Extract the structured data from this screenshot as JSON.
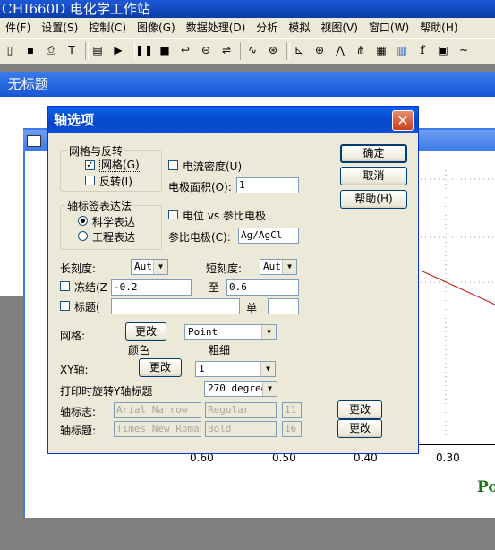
{
  "app": {
    "title": "CHI660D 电化学工作站"
  },
  "menu": [
    "件(F)",
    "设置(S)",
    "控制(C)",
    "图像(G)",
    "数据处理(D)",
    "分析",
    "模拟",
    "视图(V)",
    "窗口(W)",
    "帮助(H)"
  ],
  "toolbar_icons": [
    "new-file-icon",
    "save-icon",
    "print-icon",
    "text-icon",
    "notes-icon",
    "run-icon",
    "pause-icon",
    "stop-icon",
    "reverse-icon",
    "step-icon",
    "parameter-icon",
    "waveform-icon",
    "settings-icon",
    "graph-icon",
    "zoom-icon",
    "peak-icon",
    "overlay-icon",
    "multi-graph-icon",
    "color-icon",
    "font-icon",
    "copy-icon",
    "smooth-icon"
  ],
  "document": {
    "title": "无标题"
  },
  "plot": {
    "x_ticks": [
      "0.60",
      "0.50",
      "0.40",
      "0.30"
    ],
    "partial_label": "Po"
  },
  "dialog": {
    "title": "轴选项",
    "grid_group": {
      "title": "网格与反转",
      "grid_label": "网格(G)",
      "grid_checked": true,
      "invert_label": "反转(I)",
      "invert_checked": false
    },
    "current_density_label": "电流密度(U)",
    "current_density_checked": false,
    "electrode_area_label": "电极面积(O):",
    "electrode_area_value": "1",
    "ok_label": "确定",
    "cancel_label": "取消",
    "help_label": "帮助(H)",
    "notation_group": {
      "title": "轴标签表达法",
      "scientific_label": "科学表达",
      "engineering_label": "工程表达",
      "selected": "科学表达"
    },
    "potential_vs_ref_label": "电位 vs 参比电极",
    "potential_vs_ref_checked": false,
    "ref_electrode_label": "参比电极(C):",
    "ref_electrode_value": "Ag/AgCl",
    "major_tick_label": "长刻度:",
    "major_tick_value": "Aut",
    "minor_tick_label": "短刻度:",
    "minor_tick_value": "Aut",
    "freeze_label": "冻结(Z",
    "freeze_checked": false,
    "freeze_from": "-0.2",
    "to_label": "至",
    "freeze_to": "0.6",
    "title_label": "标题(",
    "title_checked": false,
    "title_value": "",
    "unit_label": "单",
    "unit_value": "",
    "grid_row_label": "网格:",
    "grid_change_label": "更改",
    "grid_color_caption": "颜色",
    "grid_style_value": "Point",
    "grid_weight_caption": "粗细",
    "xy_axis_label": "XY轴:",
    "xy_change_label": "更改",
    "xy_weight_value": "1",
    "rotate_label": "打印时旋转Y轴标题",
    "rotate_value": "270 degree",
    "axis_mark_label": "轴标志:",
    "axis_mark_font": "Arial Narrow",
    "axis_mark_style": "Regular",
    "axis_mark_size": "11",
    "axis_mark_change_label": "更改",
    "axis_title_label": "轴标题:",
    "axis_title_font": "Times New Roman",
    "axis_title_style": "Bold",
    "axis_title_size": "16",
    "axis_title_change_label": "更改"
  }
}
